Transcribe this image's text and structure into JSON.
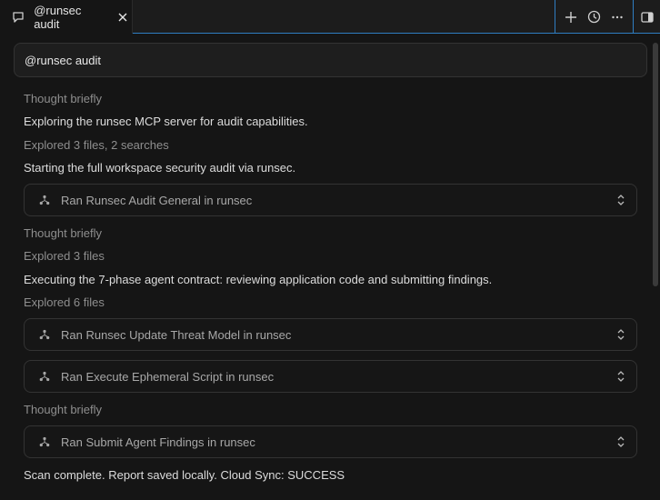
{
  "tab": {
    "icon": "chat-bubble-icon",
    "title": "@runsec audit",
    "close_icon": "close-icon"
  },
  "actions": {
    "new_icon": "plus-icon",
    "history_icon": "clock-icon",
    "more_icon": "ellipsis-icon",
    "panel_icon": "toggle-panel-icon"
  },
  "prompt": {
    "text": "@runsec audit"
  },
  "transcript": {
    "thought1": "Thought briefly",
    "msg1": "Exploring the runsec MCP server for audit capabilities.",
    "explored1": "Explored 3 files, 2 searches",
    "msg2": "Starting the full workspace security audit via runsec.",
    "tool1": "Ran Runsec Audit General in runsec",
    "thought2": "Thought briefly",
    "explored2": "Explored 3 files",
    "msg3": "Executing the 7-phase agent contract: reviewing application code and submitting findings.",
    "explored3": "Explored 6 files",
    "tool2": "Ran Runsec Update Threat Model in runsec",
    "tool3": "Ran Execute Ephemeral Script in runsec",
    "thought3": "Thought briefly",
    "tool4": "Ran Submit Agent Findings in runsec",
    "final": "Scan complete. Report saved locally. Cloud Sync: SUCCESS"
  },
  "colors": {
    "accent": "#2f7ec2",
    "background": "#151515"
  }
}
